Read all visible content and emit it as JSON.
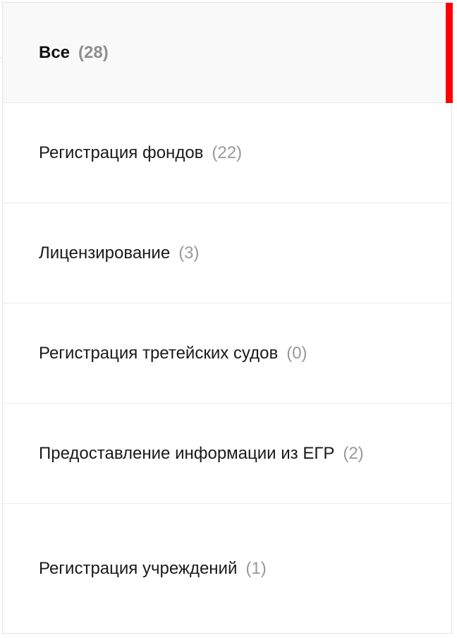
{
  "categories": {
    "items": [
      {
        "label": "Все",
        "count": "(28)"
      },
      {
        "label": "Регистрация фондов",
        "count": "(22)"
      },
      {
        "label": "Лицензирование",
        "count": "(3)"
      },
      {
        "label": "Регистрация третейских судов",
        "count": "(0)"
      },
      {
        "label": "Предоставление информации из ЕГР",
        "count": "(2)"
      },
      {
        "label": "Регистрация учреждений",
        "count": "(1)"
      }
    ],
    "active_index": 0
  },
  "colors": {
    "accent": "#ff0000",
    "count_text": "#999999",
    "active_background": "#f9f9f9"
  }
}
